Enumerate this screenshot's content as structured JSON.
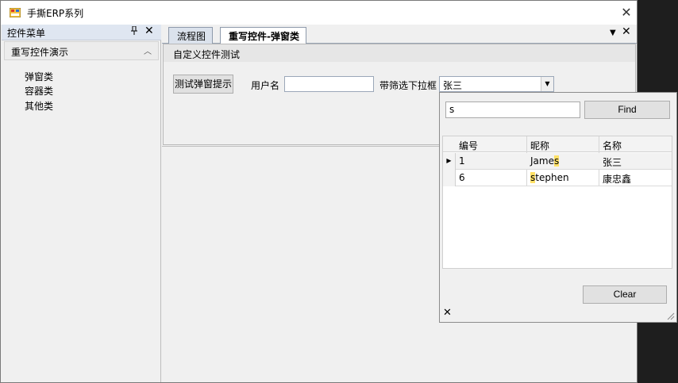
{
  "window": {
    "title": "手撕ERP系列",
    "close_glyph": "✕"
  },
  "left_panel": {
    "title": "控件菜单",
    "pin_glyph": "ꟷ",
    "close_glyph": "✕",
    "group": {
      "label": "重写控件演示",
      "chevron": "︿"
    },
    "items": [
      {
        "label": "弹窗类"
      },
      {
        "label": "容器类"
      },
      {
        "label": "其他类"
      }
    ]
  },
  "tabs": [
    {
      "label": "流程图",
      "active": false
    },
    {
      "label": "重写控件-弹窗类",
      "active": true
    }
  ],
  "tab_controls": {
    "dropdown_glyph": "▼",
    "close_glyph": "✕"
  },
  "content": {
    "title": "自定义控件测试",
    "test_button_label": "测试弹窗提示",
    "username_label": "用户名",
    "username_value": "",
    "filter_label": "带筛选下拉框",
    "filter_value": "张三",
    "filter_arrow": "▼"
  },
  "popup": {
    "search_value": "s",
    "find_label": "Find",
    "columns": [
      "编号",
      "昵称",
      "名称"
    ],
    "rows": [
      {
        "marker": "▶",
        "id": "1",
        "nick_pre": "Jame",
        "nick_hl": "s",
        "nick_post": "",
        "name": "张三"
      },
      {
        "marker": "",
        "id": "6",
        "nick_pre": "",
        "nick_hl": "s",
        "nick_post": "tephen",
        "name": "康忠鑫"
      }
    ],
    "clear_label": "Clear",
    "close_glyph": "✕"
  }
}
